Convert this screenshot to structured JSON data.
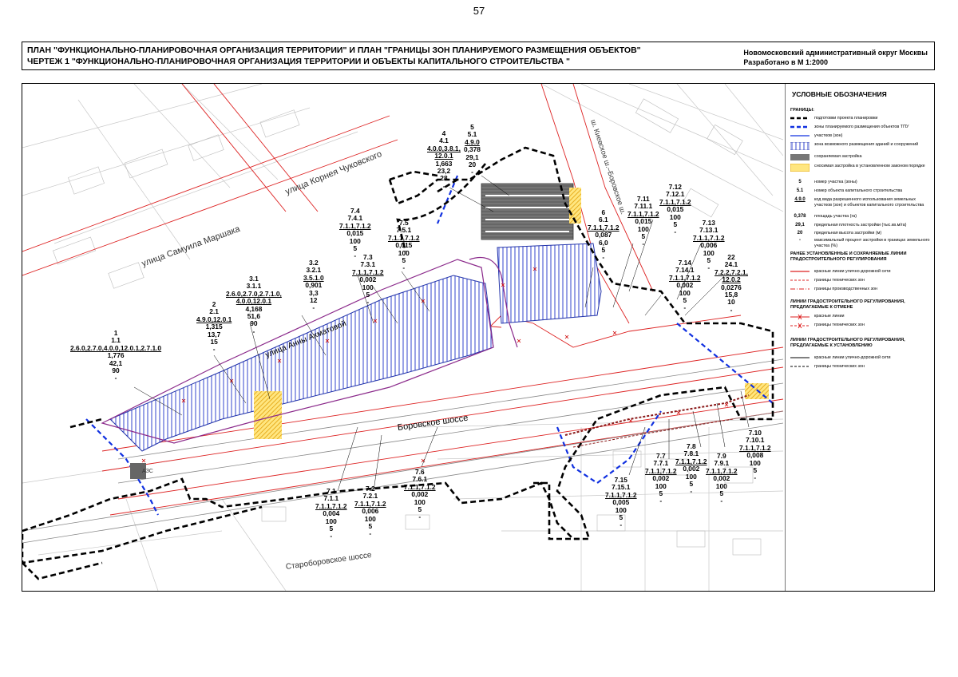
{
  "page_number": "57",
  "header": {
    "title_line1": "ПЛАН \"ФУНКЦИОНАЛЬНО-ПЛАНИРОВОЧНАЯ ОРГАНИЗАЦИЯ ТЕРРИТОРИИ\" И ПЛАН \"ГРАНИЦЫ ЗОН ПЛАНИРУЕМОГО РАЗМЕЩЕНИЯ ОБЪЕКТОВ\"",
    "title_line2": "ЧЕРТЕЖ 1 \"ФУНКЦИОНАЛЬНО-ПЛАНИРОВОЧНАЯ ОРГАНИЗАЦИЯ ТЕРРИТОРИИ И ОБЪЕКТЫ КАПИТАЛЬНОГО СТРОИТЕЛЬСТВА \"",
    "district": "Новомосковский административный округ Москвы",
    "scale": "Разработано в М 1:2000"
  },
  "streets": {
    "korney": "улица Корнея Чуковского",
    "marshak": "улица Самуила Маршака",
    "akhmatova": "улица Анны Ахматовой",
    "borovskoe": "Боровское шоссе",
    "staroborovskoe": "Староборовское шоссе",
    "kievskoe": "ш. Киевское ш.–Боровское ш.",
    "metro_label": "АЗС"
  },
  "legend": {
    "title": "УСЛОВНЫЕ ОБОЗНАЧЕНИЯ",
    "boundaries_head": "ГРАНИЦЫ:",
    "b1": "подготовки проекта планировки",
    "b2": "зоны планируемого размещения объектов ТПУ",
    "b3": "участков (зон)",
    "b4": "зона возможного размещения зданий и сооружений",
    "b5": "сохраняемая застройка",
    "b6": "сносимая застройка в установленном законом порядке",
    "s5": "5",
    "d5": "номер участка (зоны)",
    "s51": "5.1",
    "d51": "номер объекта капитального строительства",
    "s490": "4.9.0",
    "d490": "код вида разрешенного использования земельных участков (зон) и объектов капитального строительства",
    "s0378": "0,378",
    "d0378": "площадь участка (га)",
    "s291": "29,1",
    "d291": "предельная плотность застройки (тыс.кв.м/га)",
    "s20": "20",
    "d20": "предельная высота застройки (м)",
    "sdash": "-",
    "ddash": "максимальный процент застройки в границах земельного участка (%)",
    "head_prev": "РАНЕЕ УСТАНОВЛЕННЫЕ И СОХРАНЯЕМЫЕ ЛИНИИ ГРАДОСТРОИТЕЛЬНОГО РЕГУЛИРОВАНИЯ",
    "p1": "красные линии улично-дорожной сети",
    "p2": "границы технических зон",
    "p3": "границы производственных зон",
    "head_cancel": "ЛИНИИ ГРАДОСТРОИТЕЛЬНОГО РЕГУЛИРОВАНИЯ, ПРЕДЛАГАЕМЫЕ К ОТМЕНЕ",
    "c1": "красные линии",
    "c2": "границы технических зон",
    "head_new": "ЛИНИИ ГРАДОСТРОИТЕЛЬНОГО РЕГУЛИРОВАНИЯ, ПРЕДЛАГАЕМЫЕ К УСТАНОВЛЕНИЮ",
    "n1": "красные линии улично-дорожной сети",
    "n2": "границы технических зон"
  },
  "labels": [
    {
      "id": "1",
      "lines": [
        "1",
        "1.1",
        "2.6.0,2.7.0,4.0.0,12.0.1,2.7.1.0",
        "1,776",
        "42,1",
        "90",
        "-"
      ]
    },
    {
      "id": "2",
      "lines": [
        "2",
        "2.1",
        "4.9.0,12.0.1",
        "1,315",
        "13,7",
        "15",
        "-"
      ]
    },
    {
      "id": "3",
      "lines": [
        "3.1",
        "3.1.1",
        "2.6.0,2.7.0,2.7.1.0,",
        "4.0.0,12.0.1",
        "4,168",
        "51,6",
        "90",
        "-"
      ]
    },
    {
      "id": "32",
      "lines": [
        "3.2",
        "3.2.1",
        "3.5.1.0",
        "0,901",
        "3,3",
        "12",
        "-"
      ]
    },
    {
      "id": "74",
      "lines": [
        "7.4",
        "7.4.1",
        "7.1.1,7.1.2",
        "0,015",
        "100",
        "5",
        "-"
      ]
    },
    {
      "id": "73",
      "lines": [
        "7.3",
        "7.3.1",
        "7.1.1,7.1.2",
        "0,002",
        "100",
        "5",
        "-"
      ]
    },
    {
      "id": "75",
      "lines": [
        "7.5",
        "7.5.1",
        "7.1.1,7.1.2",
        "0,015",
        "100",
        "5",
        "-"
      ]
    },
    {
      "id": "4",
      "lines": [
        "4",
        "4.1",
        "4.0.0,3.8.1,",
        "12.0.1",
        "1,663",
        "23,2",
        "28",
        "-"
      ]
    },
    {
      "id": "5",
      "lines": [
        "5",
        "5.1",
        "4.9.0",
        "0,378",
        "29,1",
        "20",
        "-"
      ]
    },
    {
      "id": "6",
      "lines": [
        "6",
        "6.1",
        "7.1.1,7.1.2",
        "0,087",
        "6,0",
        "5",
        "-"
      ]
    },
    {
      "id": "711",
      "lines": [
        "7.11",
        "7.11.1",
        "7.1.1,7.1.2",
        "0,015",
        "100",
        "5",
        "-"
      ]
    },
    {
      "id": "712",
      "lines": [
        "7.12",
        "7.12.1",
        "7.1.1,7.1.2",
        "0,015",
        "100",
        "5",
        "-"
      ]
    },
    {
      "id": "713",
      "lines": [
        "7.13",
        "7.13.1",
        "7.1.1,7.1.2",
        "0,006",
        "100",
        "5",
        "-"
      ]
    },
    {
      "id": "714",
      "lines": [
        "7.14",
        "7.14.1",
        "7.1.1,7.1.2",
        "0,002",
        "100",
        "5",
        "-"
      ]
    },
    {
      "id": "22",
      "lines": [
        "22",
        "24.1",
        "7.2.2,7.2.1,",
        "12.0.2",
        "0,0276",
        "15,8",
        "10",
        "-"
      ]
    },
    {
      "id": "71",
      "lines": [
        "7.1",
        "7.1.1",
        "7.1.1,7.1.2",
        "0,004",
        "100",
        "5",
        "-"
      ]
    },
    {
      "id": "72",
      "lines": [
        "7.2",
        "7.2.1",
        "7.1.1,7.1.2",
        "0,006",
        "100",
        "5",
        "-"
      ]
    },
    {
      "id": "76",
      "lines": [
        "7.6",
        "7.6.1",
        "7.1.1,7.1.2",
        "0,002",
        "100",
        "5",
        "-"
      ]
    },
    {
      "id": "715",
      "lines": [
        "7.15",
        "7.15.1",
        "7.1.1,7.1.2",
        "0,005",
        "100",
        "5",
        "-"
      ]
    },
    {
      "id": "77",
      "lines": [
        "7.7",
        "7.7.1",
        "7.1.1,7.1.2",
        "0,002",
        "100",
        "5",
        "-"
      ]
    },
    {
      "id": "78",
      "lines": [
        "7.8",
        "7.8.1",
        "7.1.1,7.1.2",
        "0,002",
        "100",
        "5",
        "-"
      ]
    },
    {
      "id": "79",
      "lines": [
        "7.9",
        "7.9.1",
        "7.1.1,7.1.2",
        "0,002",
        "100",
        "5",
        "-"
      ]
    },
    {
      "id": "710",
      "lines": [
        "7.10",
        "7.10.1",
        "7.1.1,7.1.2",
        "0,008",
        "100",
        "5",
        "-"
      ]
    }
  ]
}
